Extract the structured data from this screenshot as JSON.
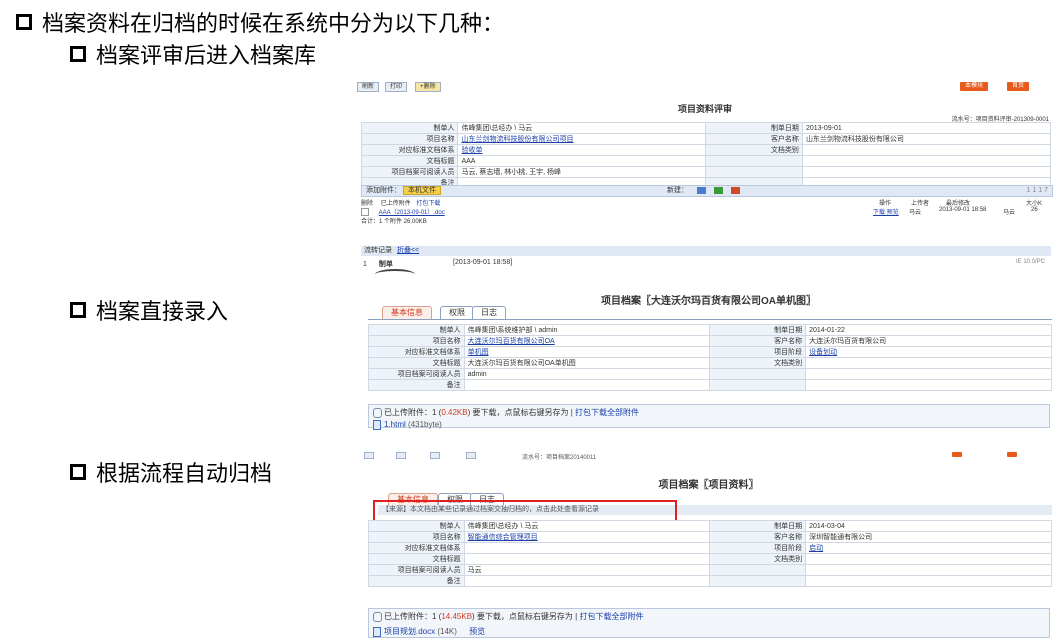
{
  "bullets": {
    "main": "档案资料在归档的时候在系统中分为以下几种：",
    "sub1": "档案评审后进入档案库",
    "sub2": "档案直接录入",
    "sub3": "根据流程自动归档"
  },
  "shot1": {
    "top_buttons": [
      "刷新",
      "打印",
      "+删除"
    ],
    "right_buttons": [
      "本模块",
      "首页"
    ],
    "title": "项目资料评审",
    "serial": "流水号：项目资料评审-201309-0001",
    "rows": [
      {
        "l1": "制单人",
        "v1": "伟峰集团\\总经办 \\ 马云",
        "l2": "制单日期",
        "v2": "2013-09-01"
      },
      {
        "l1": "项目名称",
        "v1": "山东兰剑物流科技股份有限公司项目",
        "l2": "客户名称",
        "v2": "山东兰剑物流科技股份有限公司"
      },
      {
        "l1": "对应标准文档体系",
        "v1": "验收单",
        "l2": "文档类别",
        "v2": ""
      },
      {
        "l1": "文档标题",
        "v1": "AAA",
        "l2": "",
        "v2": ""
      },
      {
        "l1": "项目档案可阅读人员",
        "v1": "马云, 蔡志墙, 林小桃, 王宇, 杨峰",
        "l2": "",
        "v2": ""
      },
      {
        "l1": "备注",
        "v1": "",
        "l2": "",
        "v2": ""
      }
    ],
    "attach_bar": {
      "label": "添加附件：",
      "button": "本机文件",
      "new_label": "新建：",
      "pager": "1 1 1 7"
    },
    "attach_header": {
      "delete": "删除",
      "uploaded": "已上传附件",
      "print": "打包下载",
      "op": "操作",
      "uploader": "上传者",
      "modified": "最后修改",
      "size": "大小K"
    },
    "attach_row": {
      "name": "AAA（2013-09-01）.doc",
      "ops": "下载 预览",
      "uploader": "马云",
      "date": "2013-09-01 18:58",
      "by": "马云",
      "size": "26"
    },
    "attach_total": "合计：1 个附件 26.00KB",
    "flow": {
      "label": "流转记录",
      "toggle": "折叠<<",
      "index": "1",
      "step": "制单",
      "time": "[2013-09-01 18:58]",
      "zoom": "IE 10.0/PC"
    }
  },
  "shot2": {
    "title": "项目档案〖大连沃尔玛百货有限公司OA单机图〗",
    "tabs": [
      "基本信息",
      "权限",
      "日志"
    ],
    "rows": [
      {
        "l1": "制单人",
        "v1": "伟峰集团\\系统维护部 \\ admin",
        "l2": "制单日期",
        "v2": "2014-01-22"
      },
      {
        "l1": "项目名称",
        "v1": "大连沃尔玛百货有限公司OA",
        "l2": "客户名称",
        "v2": "大连沃尔玛百货有限公司"
      },
      {
        "l1": "对应标准文档体系",
        "v1": "单机图",
        "l2": "项目阶段",
        "v2": "设备划动"
      },
      {
        "l1": "文档标题",
        "v1": "大连沃尔玛百货有限公司OA单机图",
        "l2": "文档类别",
        "v2": ""
      },
      {
        "l1": "项目档案可阅读人员",
        "v1": "admin",
        "l2": "",
        "v2": ""
      },
      {
        "l1": "备注",
        "v1": "",
        "l2": "",
        "v2": ""
      }
    ],
    "attach": {
      "prefix": "已上传附件：1 (",
      "size": "0.42KB",
      "suffix": ") 要下载，点鼠标右键另存为 |",
      "pack": "打包下载全部附件",
      "file": "1.html",
      "file_size": "(431byte)"
    }
  },
  "shot3": {
    "serial": "流水号：项目档案20140011",
    "title": "项目档案〖项目资料〗",
    "tabs": [
      "基本信息",
      "权限",
      "日志"
    ],
    "source_note": "【来源】本文档由某些记录通过档案交抽归档的，点击此处查看源记录",
    "rows": [
      {
        "l1": "制单人",
        "v1": "伟峰集团\\总经办 \\ 马云",
        "l2": "制单日期",
        "v2": "2014-03-04"
      },
      {
        "l1": "项目名称",
        "v1": "智能通信综合管理项目",
        "l2": "客户名称",
        "v2": "深圳智能通有限公司"
      },
      {
        "l1": "对应标准文档体系",
        "v1": "",
        "l2": "项目阶段",
        "v2": "启动"
      },
      {
        "l1": "文档标题",
        "v1": "",
        "l2": "文档类别",
        "v2": ""
      },
      {
        "l1": "项目档案可阅读人员",
        "v1": "马云",
        "l2": "",
        "v2": ""
      },
      {
        "l1": "备注",
        "v1": "",
        "l2": "",
        "v2": ""
      }
    ],
    "attach": {
      "prefix": "已上传附件：1 (",
      "size": "14.45KB",
      "suffix": ") 要下载，点鼠标右键另存为 |",
      "pack": "打包下载全部附件",
      "file": "项目规划.docx",
      "file_size": "(14K)",
      "preview": "预览"
    }
  },
  "colors": {
    "accent": "#e85a1c",
    "link": "#1a3fa8",
    "highlight_box": "#e02020"
  }
}
